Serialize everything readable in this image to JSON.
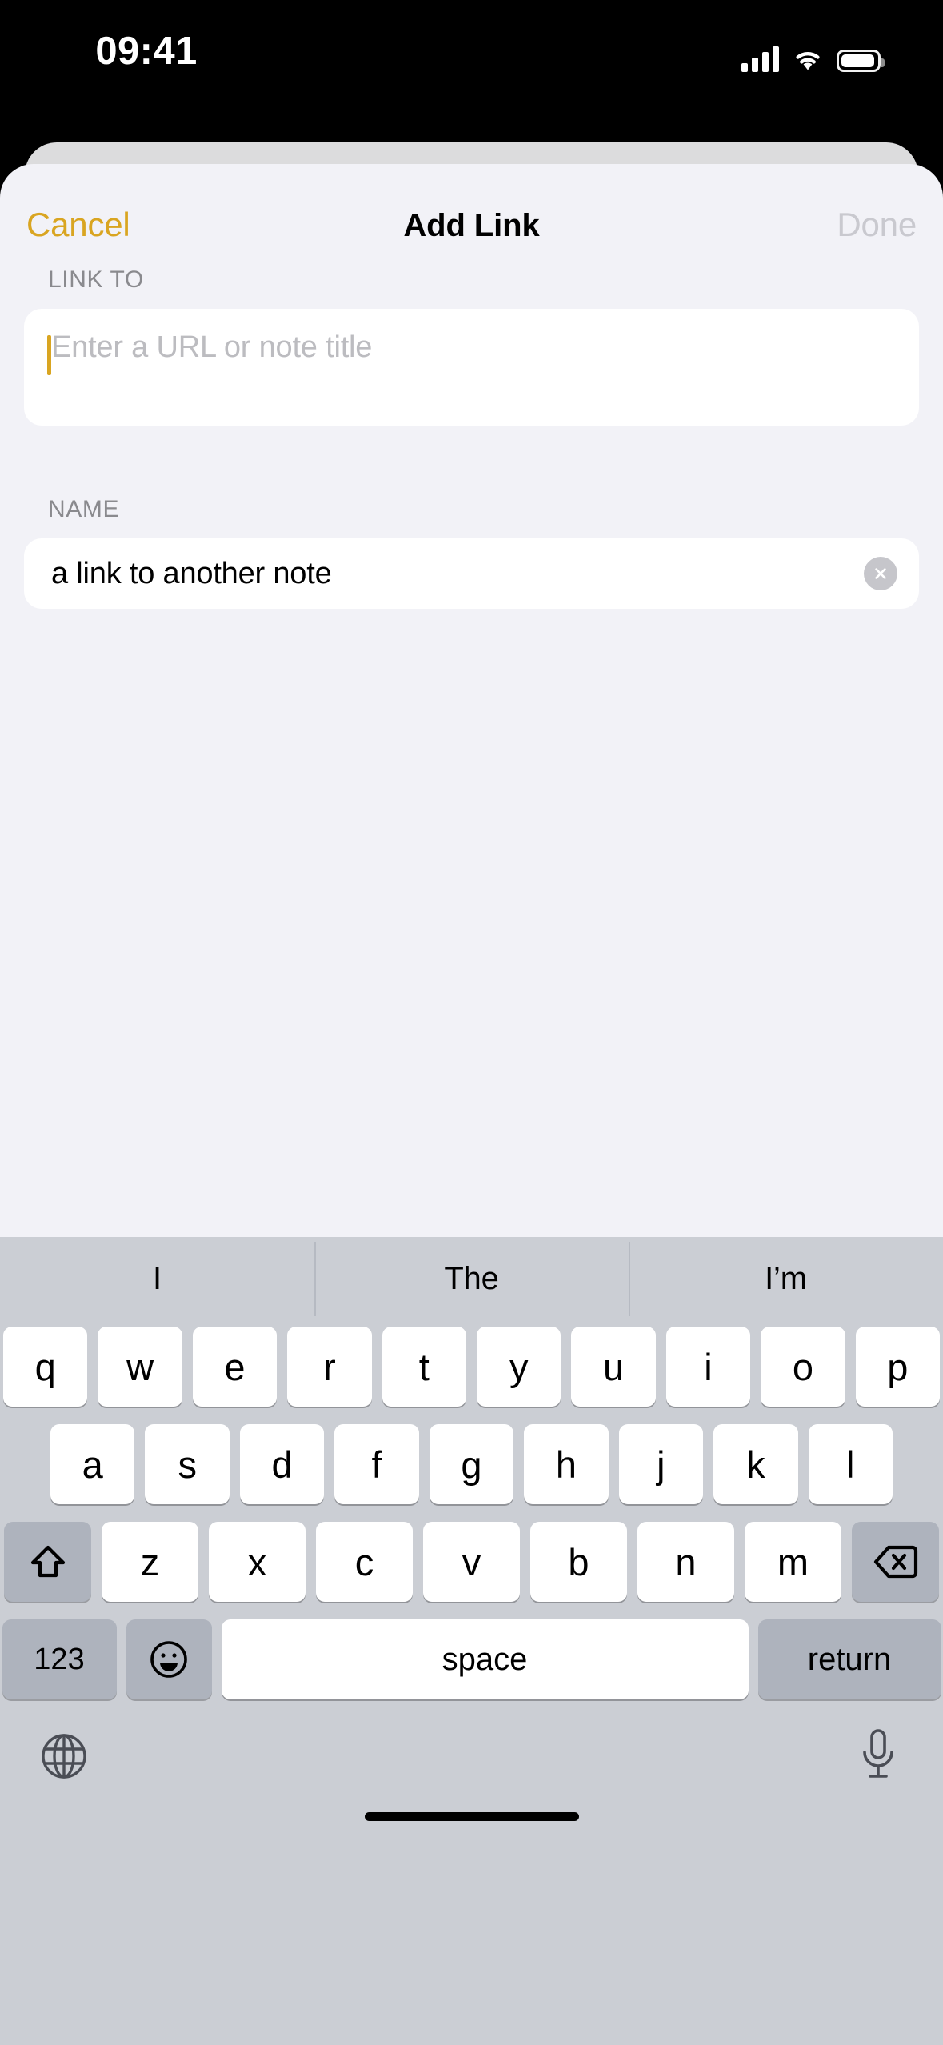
{
  "status_bar": {
    "time": "09:41",
    "signal_icon": "cellular-bars-icon",
    "wifi_icon": "wifi-icon",
    "battery_icon": "battery-icon"
  },
  "navbar": {
    "cancel_label": "Cancel",
    "title": "Add Link",
    "done_label": "Done",
    "cancel_color": "#d9a521",
    "done_color": "#c9c9cf"
  },
  "form": {
    "link_to": {
      "label": "LINK TO",
      "placeholder": "Enter a URL or note title",
      "value": "",
      "caret_color": "#d9a521"
    },
    "name": {
      "label": "NAME",
      "value": "a link to another note",
      "placeholder": "",
      "clear_icon": "clear-circle-icon"
    }
  },
  "keyboard": {
    "predictions": [
      "I",
      "The",
      "I’m"
    ],
    "row1": [
      "q",
      "w",
      "e",
      "r",
      "t",
      "y",
      "u",
      "i",
      "o",
      "p"
    ],
    "row2": [
      "a",
      "s",
      "d",
      "f",
      "g",
      "h",
      "j",
      "k",
      "l"
    ],
    "row3": [
      "z",
      "x",
      "c",
      "v",
      "b",
      "n",
      "m"
    ],
    "shift_icon": "shift-arrow-icon",
    "backspace_icon": "backspace-delete-icon",
    "numbers_label": "123",
    "emoji_icon": "emoji-smiley-icon",
    "space_label": "space",
    "return_label": "return",
    "globe_icon": "globe-icon",
    "mic_icon": "microphone-icon",
    "background_color": "#cbced4",
    "key_color": "#ffffff",
    "fn_key_color": "#aeb3bd"
  },
  "home_indicator": "home-indicator-bar"
}
